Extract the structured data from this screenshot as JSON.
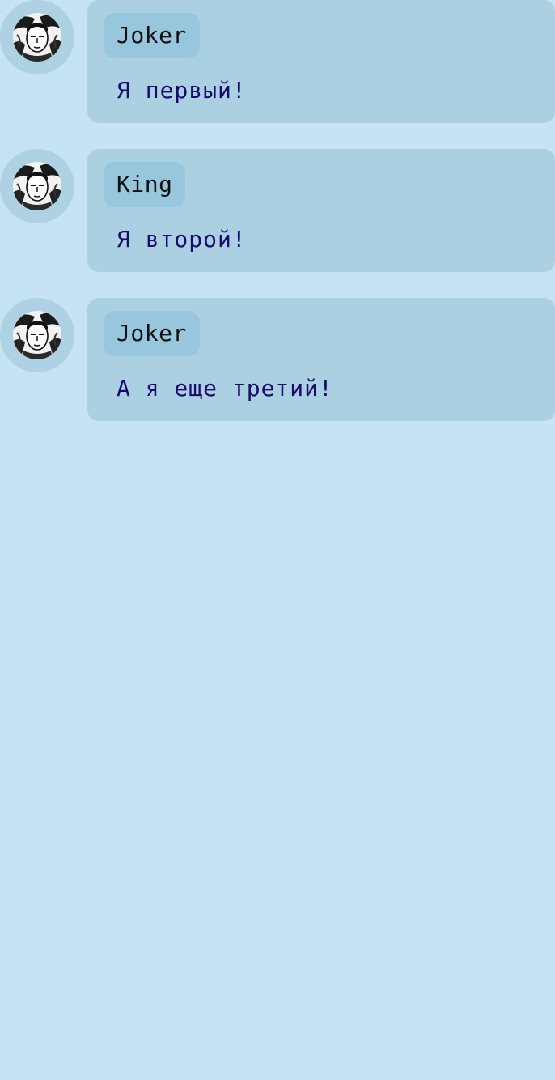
{
  "colors": {
    "background": "#c5e3f3",
    "bubble": "#abd0e2",
    "author_chip": "#98c6dd",
    "avatar_ring": "#aed2e3",
    "author_text": "#111111",
    "message_text": "#1a0a6e"
  },
  "messages": [
    {
      "author": "Joker",
      "text": "Я первый!",
      "avatar_icon": "user-avatar-icon"
    },
    {
      "author": "King",
      "text": "Я второй!",
      "avatar_icon": "user-avatar-icon"
    },
    {
      "author": "Joker",
      "text": "А я еще третий!",
      "avatar_icon": "user-avatar-icon"
    }
  ]
}
